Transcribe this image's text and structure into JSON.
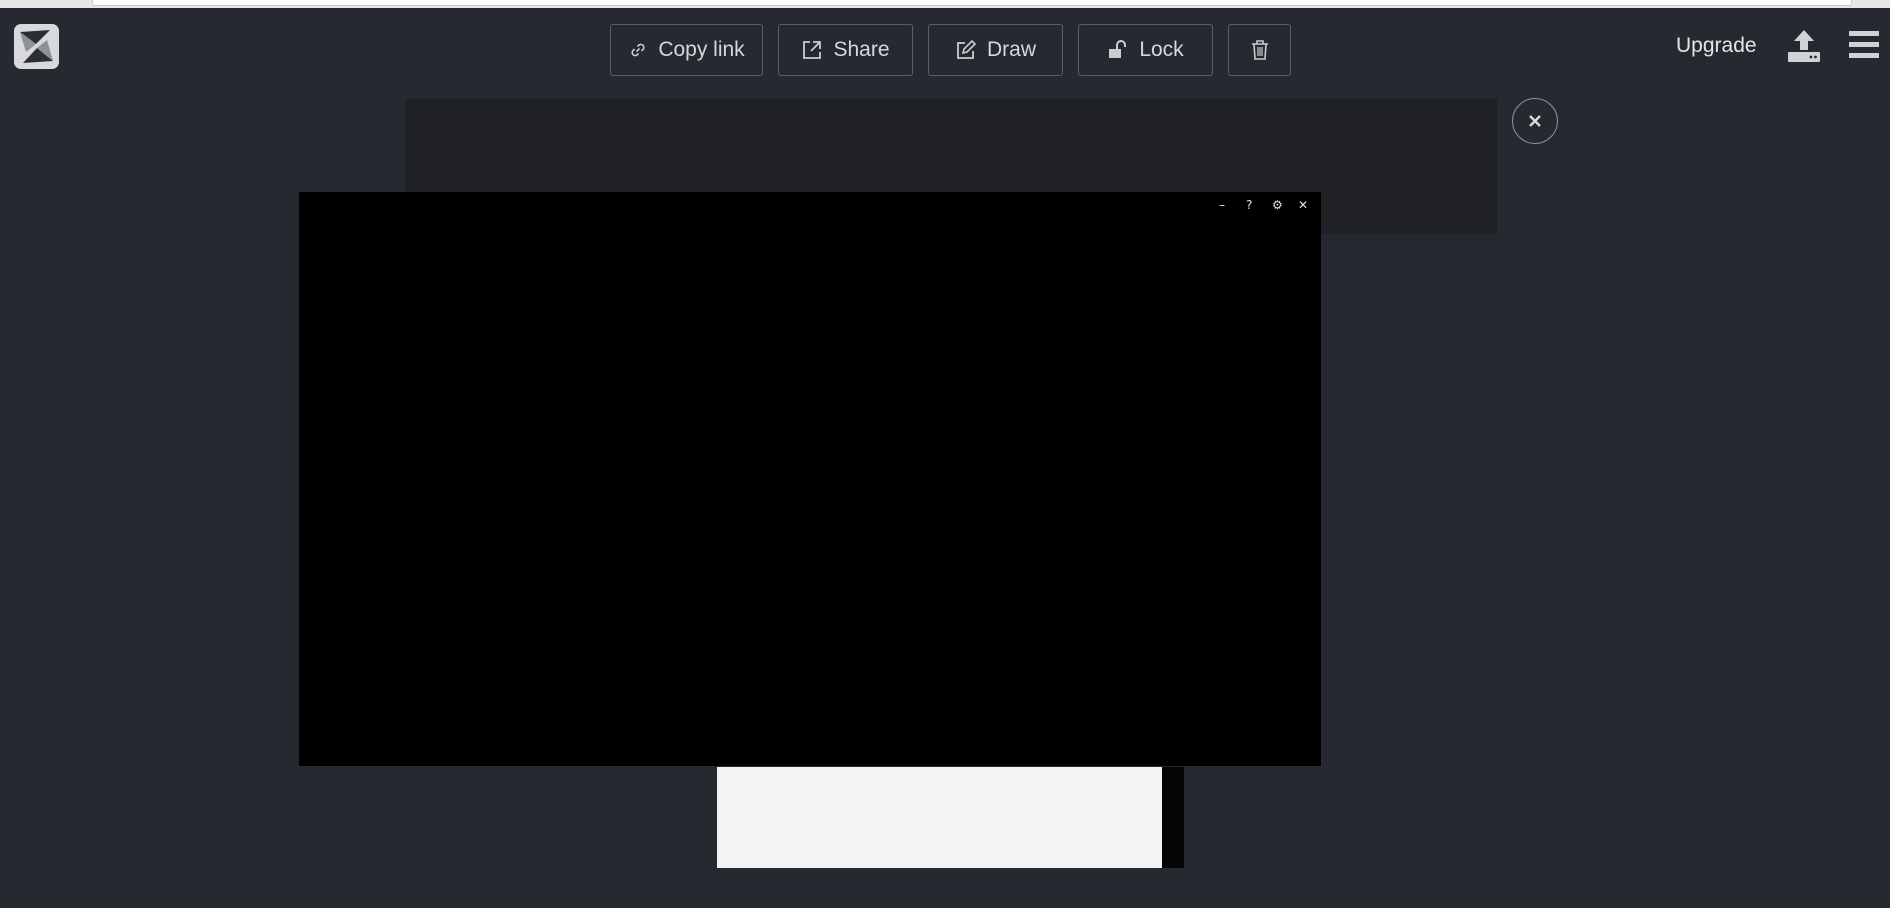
{
  "toolbar": {
    "copy_link_label": "Copy link",
    "share_label": "Share",
    "draw_label": "Draw",
    "lock_label": "Lock",
    "delete_icon": "trash-icon"
  },
  "header": {
    "upgrade_label": "Upgrade",
    "upload_icon": "upload-icon",
    "menu_icon": "hamburger-menu-icon",
    "logo_icon": "app-logo"
  },
  "video_controls": {
    "minimize": "–",
    "help": "?",
    "settings": "⚙",
    "close": "✕"
  },
  "colors": {
    "background": "#262a30",
    "banner": "#1f2126",
    "panel": "#000000",
    "preview": "#f3f3f3"
  }
}
